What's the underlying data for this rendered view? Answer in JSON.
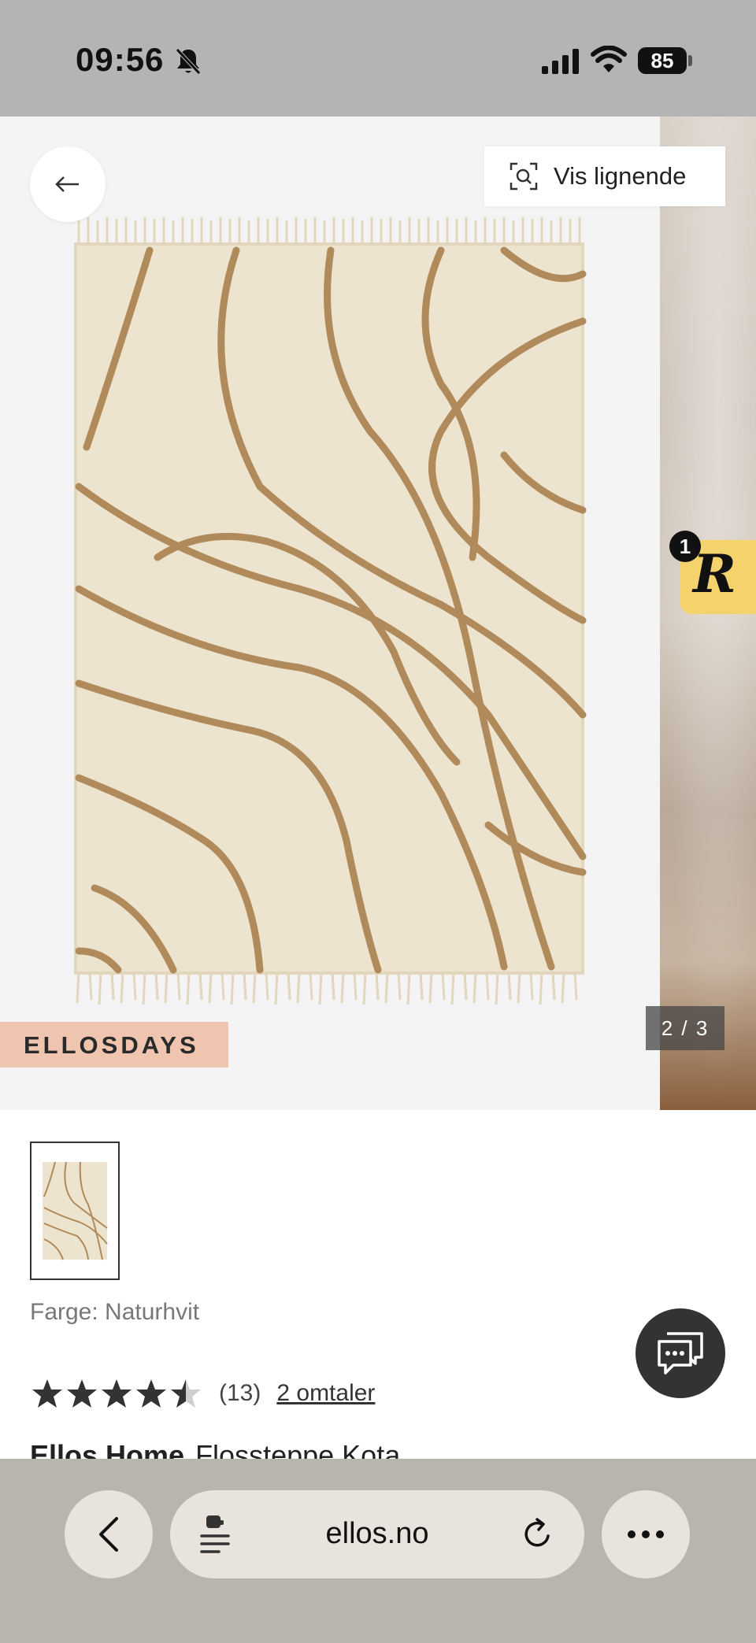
{
  "status_bar": {
    "time": "09:56",
    "battery": "85",
    "icons": [
      "bell-slash-icon",
      "cellular-signal-icon",
      "wifi-icon",
      "battery-icon"
    ]
  },
  "gallery": {
    "similar_label": "Vis lignende",
    "brand_badge": "ELLOSDAYS",
    "image_counter": "2 / 3",
    "r_widget_letter": "R",
    "r_widget_count": "1",
    "colors": {
      "background": "#f4f4f4",
      "badge": "#f0c5b0",
      "rug": "#ede4cf",
      "rug_lines": "#b08a5a",
      "widget": "#f5d36c"
    }
  },
  "product": {
    "color_line": "Farge: Naturhvit",
    "rating": 4.5,
    "rating_max": 5,
    "rating_count": "(13)",
    "reviews_link": "2 omtaler",
    "brand": "Ellos Home",
    "name": "Flossteppe Kota"
  },
  "browser": {
    "url": "ellos.no",
    "icons": [
      "chevron-left-icon",
      "reader-mode-icon",
      "reload-icon",
      "more-icon"
    ],
    "colors": {
      "bar": "#b9b4ae",
      "pill": "#e8e4dd"
    }
  }
}
